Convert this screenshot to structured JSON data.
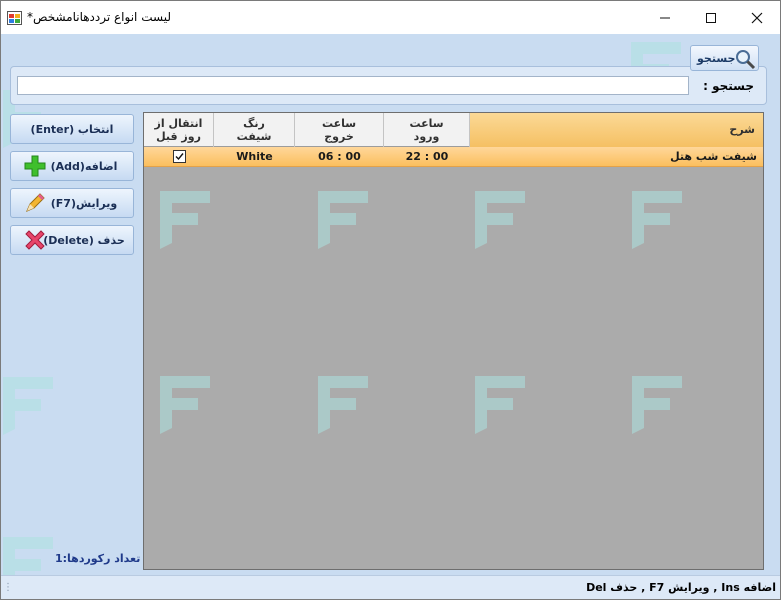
{
  "window": {
    "title": "لیست انواع ترددهانامشخص*",
    "controls": {
      "minimize": "─",
      "maximize": "☐",
      "close": "✕"
    }
  },
  "search": {
    "label": "جستجو :",
    "value": "",
    "placeholder": "",
    "button_label": "جستجو"
  },
  "actions": {
    "select_label": "انتخاب (Enter)",
    "add_label": "اضافه(Add)",
    "edit_label": "ویرایش(F7)",
    "delete_label": "حذف (Delete)"
  },
  "grid": {
    "columns": [
      {
        "key": "prev_day",
        "label_line1": "انتقال از",
        "label_line2": "روز قبل"
      },
      {
        "key": "color",
        "label_line1": "رنگ",
        "label_line2": "شیفت"
      },
      {
        "key": "exit",
        "label_line1": "ساعت",
        "label_line2": "خروج"
      },
      {
        "key": "entry",
        "label_line1": "ساعت",
        "label_line2": "ورود"
      },
      {
        "key": "desc",
        "label_line1": "شرح",
        "label_line2": ""
      }
    ],
    "rows": [
      {
        "prev_day": true,
        "color": "White",
        "exit": "06 : 00",
        "entry": "22 : 00",
        "desc": "شیفت شب هتل"
      }
    ]
  },
  "record_count": "تعداد رکوردها:1",
  "status_bar": "اضافه Ins , ویرایش F7 , حذف Del",
  "colors": {
    "selected_row": "#fbc76f",
    "header_desc": "#f7c66e",
    "grid_bg": "#ababab",
    "panel_bg": "#c9dcf1"
  }
}
